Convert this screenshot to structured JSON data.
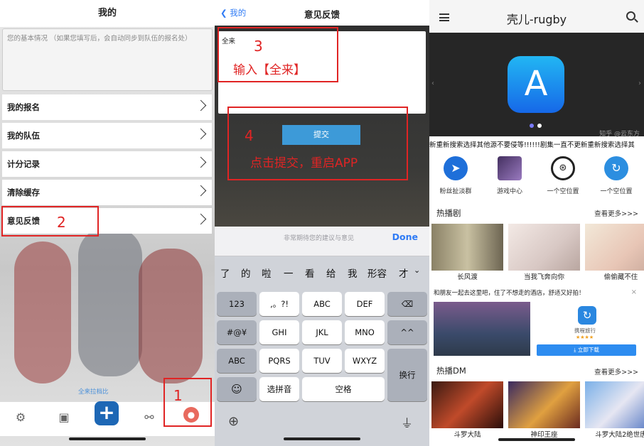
{
  "panel1": {
    "header_title": "我的",
    "info_placeholder": "您的基本情况 （如果您填写后，会自动同步到队伍的报名处）",
    "menu": [
      "我的报名",
      "我的队伍",
      "计分记录",
      "清除缓存",
      "意见反馈"
    ],
    "footer_link": "全来拉档比",
    "step_labels": {
      "one": "1",
      "two": "2"
    },
    "tabs": [
      "home-icon",
      "profile-card-icon",
      "add-icon",
      "match-icon",
      "user-icon"
    ]
  },
  "panel2": {
    "back_label": "我的",
    "title": "意见反馈",
    "input_value": "全来",
    "step3_number": "3",
    "step3_text": "输入【全来】",
    "submit_label": "提交",
    "step4_number": "4",
    "step4_text": "点击提交，重启APP",
    "accessory_placeholder": "非常期待您的建议与意见",
    "done_label": "Done",
    "candidates": [
      "了",
      "的",
      "啦",
      "一",
      "看",
      "给",
      "我",
      "形容",
      "才"
    ],
    "keys": {
      "row1": [
        "123",
        ",。?!",
        "ABC",
        "DEF"
      ],
      "row2": [
        "#@¥",
        "GHI",
        "JKL",
        "MNO",
        "^^"
      ],
      "row3": [
        "ABC",
        "PQRS",
        "TUV",
        "WXYZ"
      ],
      "row4": [
        "选拼音",
        "空格"
      ],
      "enter": "换行"
    }
  },
  "panel3": {
    "title": "壳儿-rugby",
    "watermark": "知乎 @云东方",
    "marquee": "新重新搜索选择其他源不要侵等!!!!!!剧集一直不更新重新搜索选择其",
    "shortcuts": [
      "粉丝扯淡群",
      "游戏中心",
      "一个空位置",
      "一个空位置"
    ],
    "section1_title": "热播剧",
    "section1_more": "查看更多>>>",
    "section1_items": [
      "长风渡",
      "当我飞奔向你",
      "偷偷藏不住"
    ],
    "ad_text": "和朋友一起去这里吧，住了不想走的酒店，舒适又好拍！",
    "ad_brand": "携程旅行",
    "ad_rating": "★★★★",
    "ad_button": "⤓ 立即下载",
    "section2_title": "热播DM",
    "section2_more": "查看更多>>>",
    "section2_items": [
      "斗罗大陆",
      "神印王座",
      "斗罗大陆2绝世唐"
    ]
  },
  "colors": {
    "annotation_red": "#e02424",
    "ios_blue": "#2f7bf5",
    "brand_blue": "#1d67b5"
  }
}
